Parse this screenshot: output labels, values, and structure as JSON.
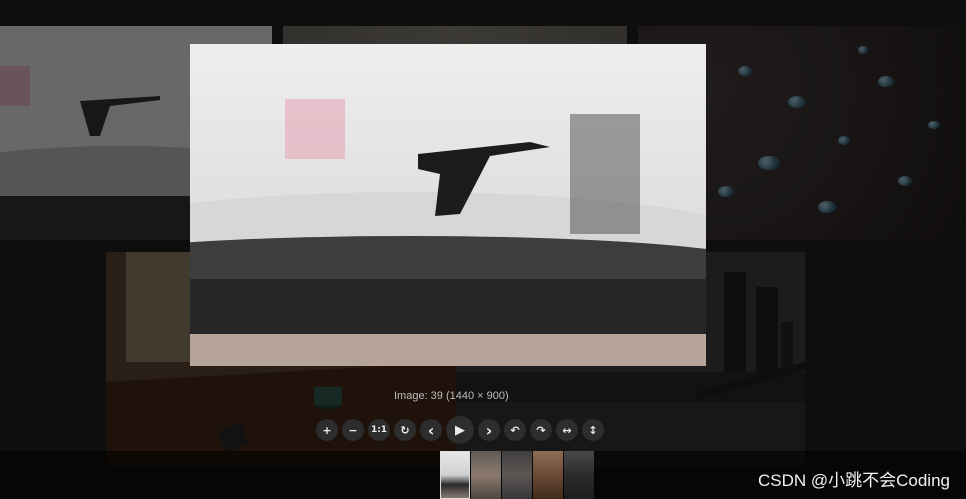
{
  "caption": "Image: 39 (1440 × 900)",
  "toolbar": {
    "items": [
      {
        "icon": "plus-icon",
        "glyph": "+"
      },
      {
        "icon": "minus-icon",
        "glyph": "−"
      },
      {
        "icon": "one-to-one-icon",
        "glyph": "1:1"
      },
      {
        "icon": "reset-rotate-icon",
        "glyph": "↻"
      },
      {
        "icon": "chevron-left-icon",
        "glyph": "‹"
      },
      {
        "icon": "play-icon",
        "glyph": "▶"
      },
      {
        "icon": "chevron-right-icon",
        "glyph": "›"
      },
      {
        "icon": "rotate-left-icon",
        "glyph": "↶"
      },
      {
        "icon": "rotate-right-icon",
        "glyph": "↷"
      },
      {
        "icon": "flip-horizontal-icon",
        "glyph": "↔"
      },
      {
        "icon": "flip-vertical-icon",
        "glyph": "↕"
      }
    ]
  },
  "thumbnails": [
    {
      "icon": "turntable-thumbnail",
      "active": true
    },
    {
      "icon": "plant-thumbnail",
      "active": false
    },
    {
      "icon": "water-thumbnail",
      "active": false
    },
    {
      "icon": "room-thumbnail",
      "active": false
    },
    {
      "icon": "city-thumbnail",
      "active": false
    }
  ],
  "watermark": "CSDN @小跳不会Coding"
}
